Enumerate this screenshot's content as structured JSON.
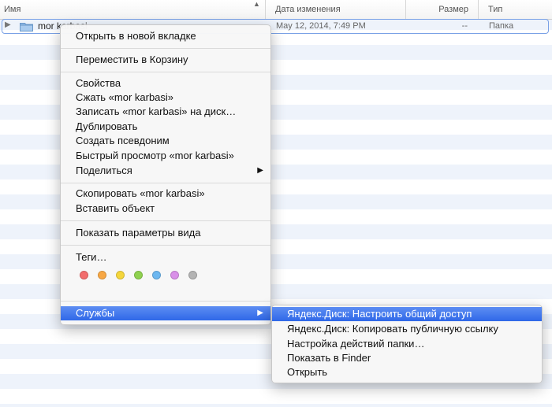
{
  "columns": {
    "name": "Имя",
    "date": "Дата изменения",
    "size": "Размер",
    "kind": "Тип",
    "sort_icon": "sort-up-triangle"
  },
  "file_row": {
    "name": "mor karbasi",
    "date": "May 12, 2014, 7:49 PM",
    "size": "--",
    "kind": "Папка",
    "icon": "folder-icon"
  },
  "context_menu": {
    "open_new_tab": "Открыть в новой вкладке",
    "move_to_trash": "Переместить в Корзину",
    "get_info": "Свойства",
    "compress": "Сжать «mor karbasi»",
    "burn": "Записать «mor karbasi» на диск…",
    "duplicate": "Дублировать",
    "make_alias": "Создать псевдоним",
    "quick_look": "Быстрый просмотр «mor karbasi»",
    "share": "Поделиться",
    "copy": "Скопировать «mor karbasi»",
    "paste": "Вставить объект",
    "show_view_options": "Показать параметры вида",
    "tags": "Теги…",
    "services": "Службы"
  },
  "tag_colors": [
    "#f26d6d",
    "#f7a744",
    "#f5d63c",
    "#8fd14f",
    "#6cb7f0",
    "#d990e8",
    "#b4b4b4"
  ],
  "services_submenu": {
    "yandex_share": "Яндекс.Диск: Настроить общий доступ",
    "yandex_copy_link": "Яндекс.Диск: Копировать публичную ссылку",
    "folder_actions": "Настройка действий папки…",
    "show_in_finder": "Показать в Finder",
    "open": "Открыть"
  },
  "colors": {
    "highlight": "#3a72ea",
    "row_stripe": "#eef3fb"
  }
}
